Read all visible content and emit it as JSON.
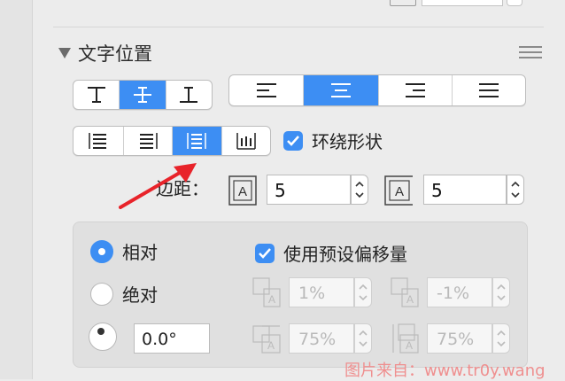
{
  "section": {
    "title": "文字位置"
  },
  "vertical_align_buttons": [
    "top-align-icon",
    "middle-align-icon",
    "bottom-align-icon"
  ],
  "vertical_align_selected": 1,
  "horizontal_align_buttons": [
    "align-left-icon",
    "align-center-icon",
    "align-right-icon",
    "justify-icon"
  ],
  "horizontal_align_selected": 1,
  "wrap_style_buttons": [
    "wrap-left-icon",
    "wrap-right-icon",
    "wrap-full-icon",
    "wrap-bottom-icon"
  ],
  "wrap_style_selected": 2,
  "wrap_shape": {
    "label": "环绕形状",
    "checked": true
  },
  "margin": {
    "label": "边距：",
    "inset_value": "5",
    "padding_value": "5"
  },
  "position_mode": {
    "relative_label": "相对",
    "absolute_label": "绝对",
    "selected": "relative"
  },
  "angle": {
    "value": "0.0°"
  },
  "preset_offset": {
    "label": "使用预设偏移量",
    "checked": true,
    "horizontal_offset": "1%",
    "vertical_offset": "-1%",
    "width_percent": "75%",
    "height_percent": "75%"
  },
  "watermark": "图片来自：www.tr0y.wang",
  "colors": {
    "accent": "#3d8ef3",
    "arrow": "#e8232a",
    "watermark": "#ef8f8f"
  }
}
